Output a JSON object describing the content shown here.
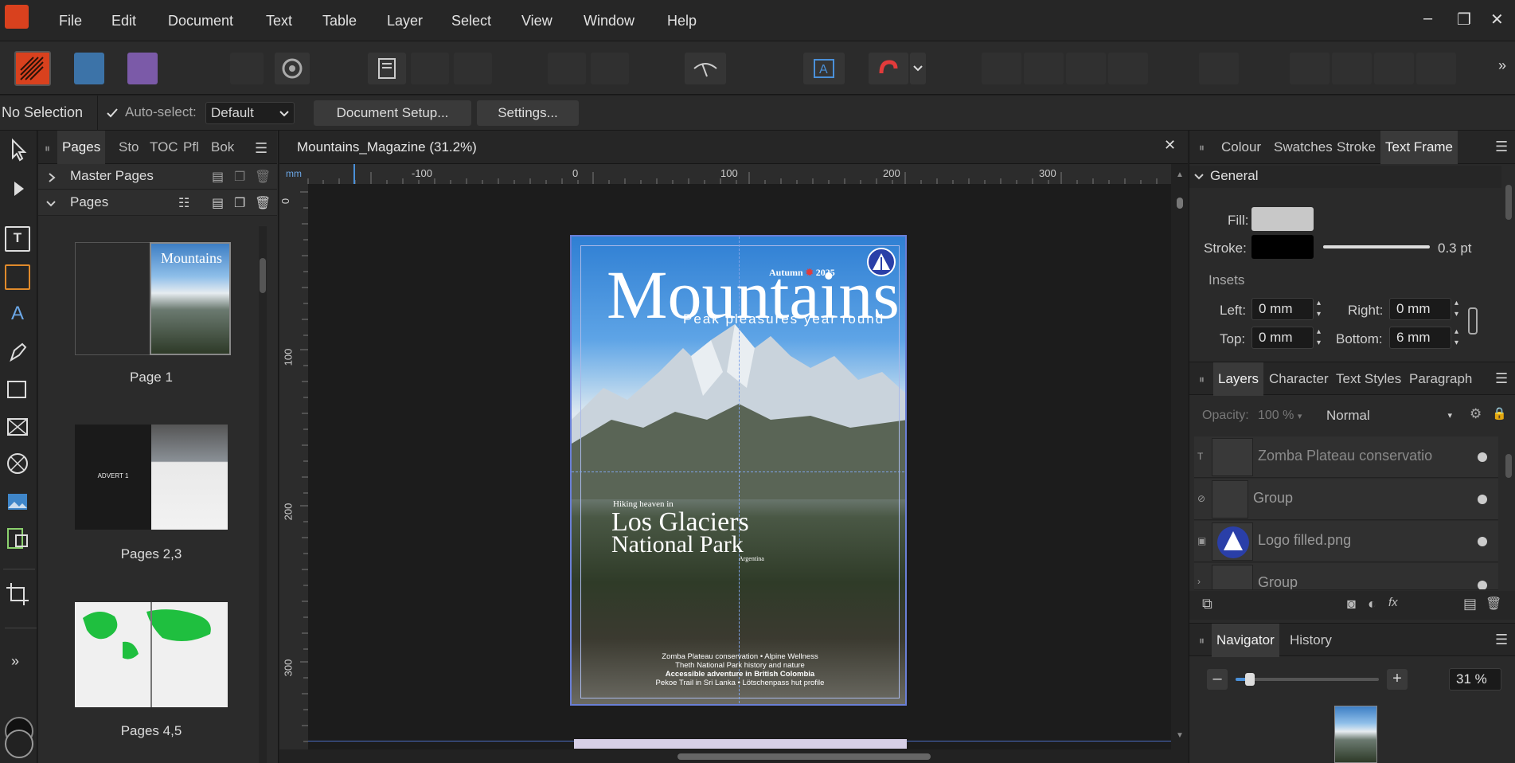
{
  "menubar": {
    "items": [
      "File",
      "Edit",
      "Document",
      "Text",
      "Table",
      "Layer",
      "Select",
      "View",
      "Window",
      "Help"
    ],
    "window_controls": [
      "–",
      "❐",
      "✕"
    ]
  },
  "context": {
    "selection": "No Selection",
    "autoselect_label": "Auto-select:",
    "autoselect_value": "Default",
    "document_setup": "Document Setup...",
    "settings": "Settings..."
  },
  "pages_panel": {
    "tabs": [
      "Pages",
      "Sto",
      "TOC",
      "Pfl",
      "Bok"
    ],
    "master_pages": "Master Pages",
    "pages": "Pages",
    "thumbs": [
      "Page 1",
      "Pages 2,3",
      "Pages 4,5"
    ],
    "advert_label": "ADVERT 1"
  },
  "document": {
    "tab_title": "Mountains_Magazine (31.2%)",
    "ruler_unit": "mm",
    "h_ticks": [
      "-100",
      "0",
      "100",
      "200",
      "300"
    ],
    "v_ticks": [
      "0",
      "100",
      "200",
      "300"
    ],
    "cover": {
      "issue": "Autumn",
      "year": "2025",
      "title": "Mountains",
      "tagline": "Peak pleasures year round",
      "kicker": "Hiking heaven in",
      "feature_line1": "Los Glaciers",
      "feature_line2": "National Park",
      "feature_sub": "Argentina",
      "lines": [
        "Zomba Plateau conservation • Alpine Wellness",
        "Theth National Park history and nature",
        "Accessible adventure in British Colombia",
        "Pekoe Trail in Sri Lanka • Lötschenpass hut profile"
      ]
    }
  },
  "right_panel": {
    "top_tabs": [
      "Colour",
      "Swatches",
      "Stroke",
      "Text Frame"
    ],
    "section": "General",
    "fill_label": "Fill:",
    "stroke_label": "Stroke:",
    "stroke_value": "0.3 pt",
    "insets_label": "Insets",
    "left_label": "Left:",
    "left_value": "0 mm",
    "right_label": "Right:",
    "right_value": "0 mm",
    "top_label": "Top:",
    "top_value": "0 mm",
    "bottom_label": "Bottom:",
    "bottom_value": "6 mm",
    "layer_tabs": [
      "Layers",
      "Character",
      "Text Styles",
      "Paragraph"
    ],
    "opacity_label": "Opacity:",
    "opacity_value": "100 %",
    "blend_value": "Normal",
    "layers": [
      "Zomba Plateau conservatio",
      "Group",
      "Logo filled.png",
      "Group"
    ],
    "nav_tabs": [
      "Navigator",
      "History"
    ],
    "zoom_value": "31 %",
    "zoom_fraction": 0.1
  },
  "colors": {
    "accent": "#4a90d9",
    "fill_swatch": "#c8c8c8",
    "stroke_swatch": "#000000",
    "app_icon": "#d9411e"
  }
}
